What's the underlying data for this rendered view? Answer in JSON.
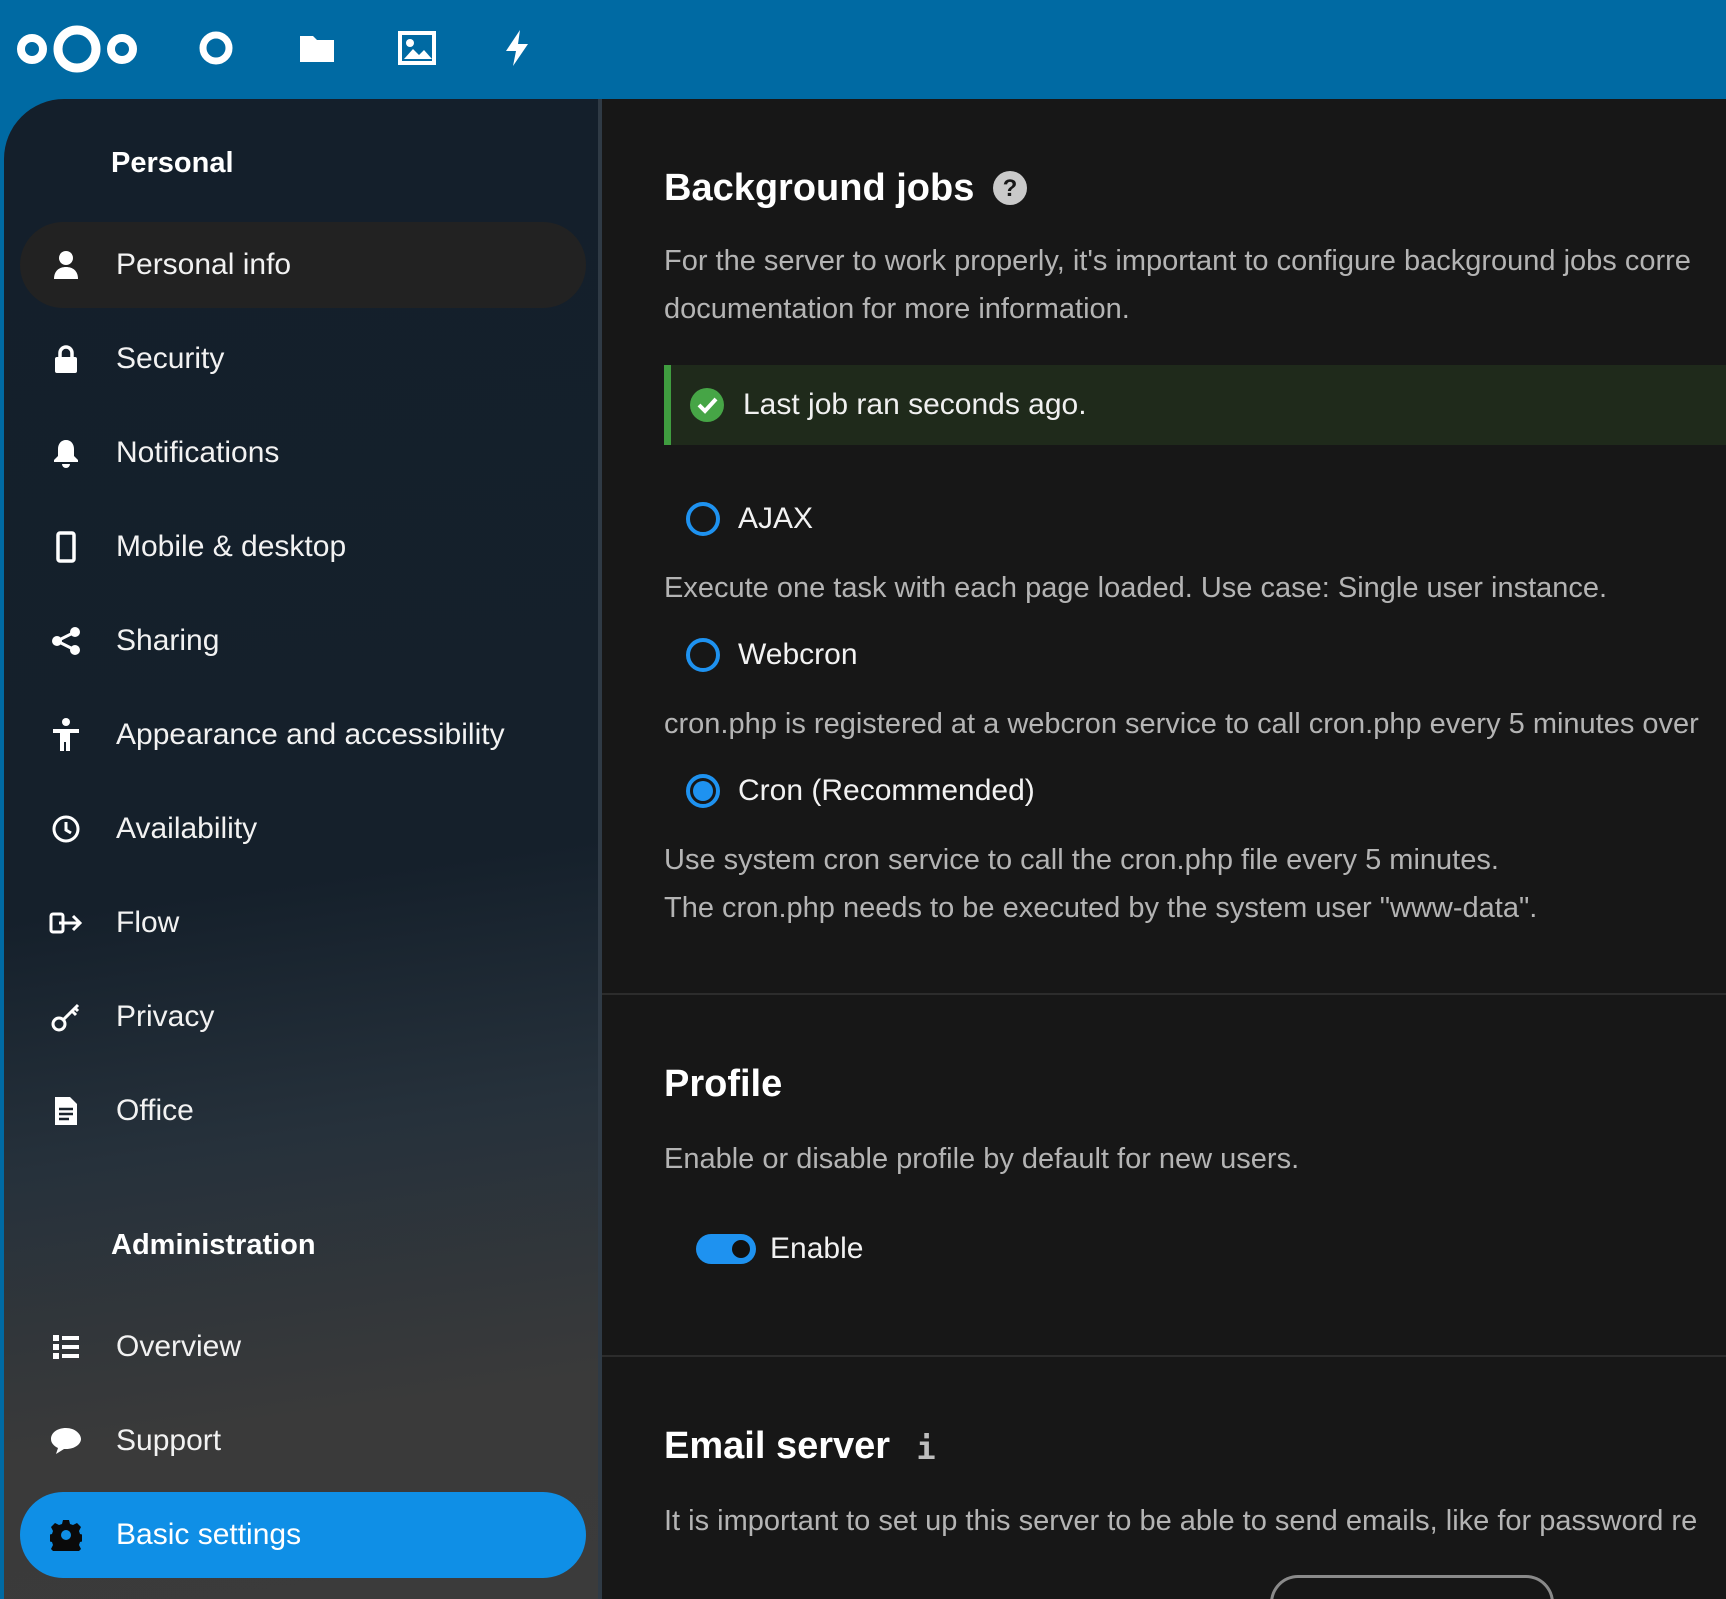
{
  "header": {
    "logo": "nextcloud-logo",
    "apps": [
      {
        "name": "dashboard",
        "icon": "circle-icon"
      },
      {
        "name": "files",
        "icon": "folder-icon"
      },
      {
        "name": "photos",
        "icon": "image-icon"
      },
      {
        "name": "activity",
        "icon": "lightning-icon"
      }
    ]
  },
  "sidebar": {
    "personal_heading": "Personal",
    "personal_items": [
      {
        "label": "Personal info",
        "icon": "user-icon"
      },
      {
        "label": "Security",
        "icon": "lock-icon"
      },
      {
        "label": "Notifications",
        "icon": "bell-icon"
      },
      {
        "label": "Mobile & desktop",
        "icon": "phone-icon"
      },
      {
        "label": "Sharing",
        "icon": "share-icon"
      },
      {
        "label": "Appearance and accessibility",
        "icon": "accessibility-icon"
      },
      {
        "label": "Availability",
        "icon": "clock-icon"
      },
      {
        "label": "Flow",
        "icon": "flow-icon"
      },
      {
        "label": "Privacy",
        "icon": "key-icon"
      },
      {
        "label": "Office",
        "icon": "document-icon"
      }
    ],
    "admin_heading": "Administration",
    "admin_items": [
      {
        "label": "Overview",
        "icon": "list-icon"
      },
      {
        "label": "Support",
        "icon": "chat-icon"
      },
      {
        "label": "Basic settings",
        "icon": "gear-icon"
      }
    ],
    "active_item": "Basic settings"
  },
  "background_jobs": {
    "title": "Background jobs",
    "description_line1": "For the server to work properly, it's important to configure background jobs corre",
    "description_line2": "documentation for more information.",
    "status": "Last job ran seconds ago.",
    "options": [
      {
        "label": "AJAX",
        "selected": false,
        "description": "Execute one task with each page loaded. Use case: Single user instance."
      },
      {
        "label": "Webcron",
        "selected": false,
        "description": "cron.php is registered at a webcron service to call cron.php every 5 minutes over"
      },
      {
        "label": "Cron (Recommended)",
        "selected": true,
        "description": "Use system cron service to call the cron.php file every 5 minutes."
      }
    ],
    "cron_note": "The cron.php needs to be executed by the system user \"www-data\"."
  },
  "profile": {
    "title": "Profile",
    "description": "Enable or disable profile by default for new users.",
    "toggle_label": "Enable",
    "enabled": true
  },
  "email_server": {
    "title": "Email server",
    "description": "It is important to set up this server to be able to send emails, like for password re"
  },
  "colors": {
    "header": "#006aa3",
    "accent": "#1e92f0",
    "success": "#3f9d3f"
  }
}
